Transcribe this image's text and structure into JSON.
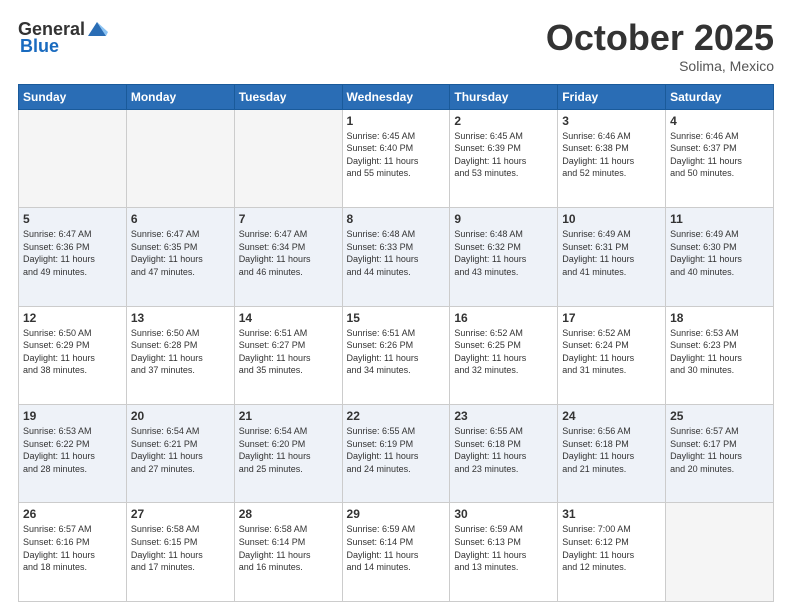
{
  "header": {
    "logo_general": "General",
    "logo_blue": "Blue",
    "month": "October 2025",
    "location": "Solima, Mexico"
  },
  "days_of_week": [
    "Sunday",
    "Monday",
    "Tuesday",
    "Wednesday",
    "Thursday",
    "Friday",
    "Saturday"
  ],
  "weeks": [
    [
      {
        "day": "",
        "info": ""
      },
      {
        "day": "",
        "info": ""
      },
      {
        "day": "",
        "info": ""
      },
      {
        "day": "1",
        "info": "Sunrise: 6:45 AM\nSunset: 6:40 PM\nDaylight: 11 hours\nand 55 minutes."
      },
      {
        "day": "2",
        "info": "Sunrise: 6:45 AM\nSunset: 6:39 PM\nDaylight: 11 hours\nand 53 minutes."
      },
      {
        "day": "3",
        "info": "Sunrise: 6:46 AM\nSunset: 6:38 PM\nDaylight: 11 hours\nand 52 minutes."
      },
      {
        "day": "4",
        "info": "Sunrise: 6:46 AM\nSunset: 6:37 PM\nDaylight: 11 hours\nand 50 minutes."
      }
    ],
    [
      {
        "day": "5",
        "info": "Sunrise: 6:47 AM\nSunset: 6:36 PM\nDaylight: 11 hours\nand 49 minutes."
      },
      {
        "day": "6",
        "info": "Sunrise: 6:47 AM\nSunset: 6:35 PM\nDaylight: 11 hours\nand 47 minutes."
      },
      {
        "day": "7",
        "info": "Sunrise: 6:47 AM\nSunset: 6:34 PM\nDaylight: 11 hours\nand 46 minutes."
      },
      {
        "day": "8",
        "info": "Sunrise: 6:48 AM\nSunset: 6:33 PM\nDaylight: 11 hours\nand 44 minutes."
      },
      {
        "day": "9",
        "info": "Sunrise: 6:48 AM\nSunset: 6:32 PM\nDaylight: 11 hours\nand 43 minutes."
      },
      {
        "day": "10",
        "info": "Sunrise: 6:49 AM\nSunset: 6:31 PM\nDaylight: 11 hours\nand 41 minutes."
      },
      {
        "day": "11",
        "info": "Sunrise: 6:49 AM\nSunset: 6:30 PM\nDaylight: 11 hours\nand 40 minutes."
      }
    ],
    [
      {
        "day": "12",
        "info": "Sunrise: 6:50 AM\nSunset: 6:29 PM\nDaylight: 11 hours\nand 38 minutes."
      },
      {
        "day": "13",
        "info": "Sunrise: 6:50 AM\nSunset: 6:28 PM\nDaylight: 11 hours\nand 37 minutes."
      },
      {
        "day": "14",
        "info": "Sunrise: 6:51 AM\nSunset: 6:27 PM\nDaylight: 11 hours\nand 35 minutes."
      },
      {
        "day": "15",
        "info": "Sunrise: 6:51 AM\nSunset: 6:26 PM\nDaylight: 11 hours\nand 34 minutes."
      },
      {
        "day": "16",
        "info": "Sunrise: 6:52 AM\nSunset: 6:25 PM\nDaylight: 11 hours\nand 32 minutes."
      },
      {
        "day": "17",
        "info": "Sunrise: 6:52 AM\nSunset: 6:24 PM\nDaylight: 11 hours\nand 31 minutes."
      },
      {
        "day": "18",
        "info": "Sunrise: 6:53 AM\nSunset: 6:23 PM\nDaylight: 11 hours\nand 30 minutes."
      }
    ],
    [
      {
        "day": "19",
        "info": "Sunrise: 6:53 AM\nSunset: 6:22 PM\nDaylight: 11 hours\nand 28 minutes."
      },
      {
        "day": "20",
        "info": "Sunrise: 6:54 AM\nSunset: 6:21 PM\nDaylight: 11 hours\nand 27 minutes."
      },
      {
        "day": "21",
        "info": "Sunrise: 6:54 AM\nSunset: 6:20 PM\nDaylight: 11 hours\nand 25 minutes."
      },
      {
        "day": "22",
        "info": "Sunrise: 6:55 AM\nSunset: 6:19 PM\nDaylight: 11 hours\nand 24 minutes."
      },
      {
        "day": "23",
        "info": "Sunrise: 6:55 AM\nSunset: 6:18 PM\nDaylight: 11 hours\nand 23 minutes."
      },
      {
        "day": "24",
        "info": "Sunrise: 6:56 AM\nSunset: 6:18 PM\nDaylight: 11 hours\nand 21 minutes."
      },
      {
        "day": "25",
        "info": "Sunrise: 6:57 AM\nSunset: 6:17 PM\nDaylight: 11 hours\nand 20 minutes."
      }
    ],
    [
      {
        "day": "26",
        "info": "Sunrise: 6:57 AM\nSunset: 6:16 PM\nDaylight: 11 hours\nand 18 minutes."
      },
      {
        "day": "27",
        "info": "Sunrise: 6:58 AM\nSunset: 6:15 PM\nDaylight: 11 hours\nand 17 minutes."
      },
      {
        "day": "28",
        "info": "Sunrise: 6:58 AM\nSunset: 6:14 PM\nDaylight: 11 hours\nand 16 minutes."
      },
      {
        "day": "29",
        "info": "Sunrise: 6:59 AM\nSunset: 6:14 PM\nDaylight: 11 hours\nand 14 minutes."
      },
      {
        "day": "30",
        "info": "Sunrise: 6:59 AM\nSunset: 6:13 PM\nDaylight: 11 hours\nand 13 minutes."
      },
      {
        "day": "31",
        "info": "Sunrise: 7:00 AM\nSunset: 6:12 PM\nDaylight: 11 hours\nand 12 minutes."
      },
      {
        "day": "",
        "info": ""
      }
    ]
  ]
}
